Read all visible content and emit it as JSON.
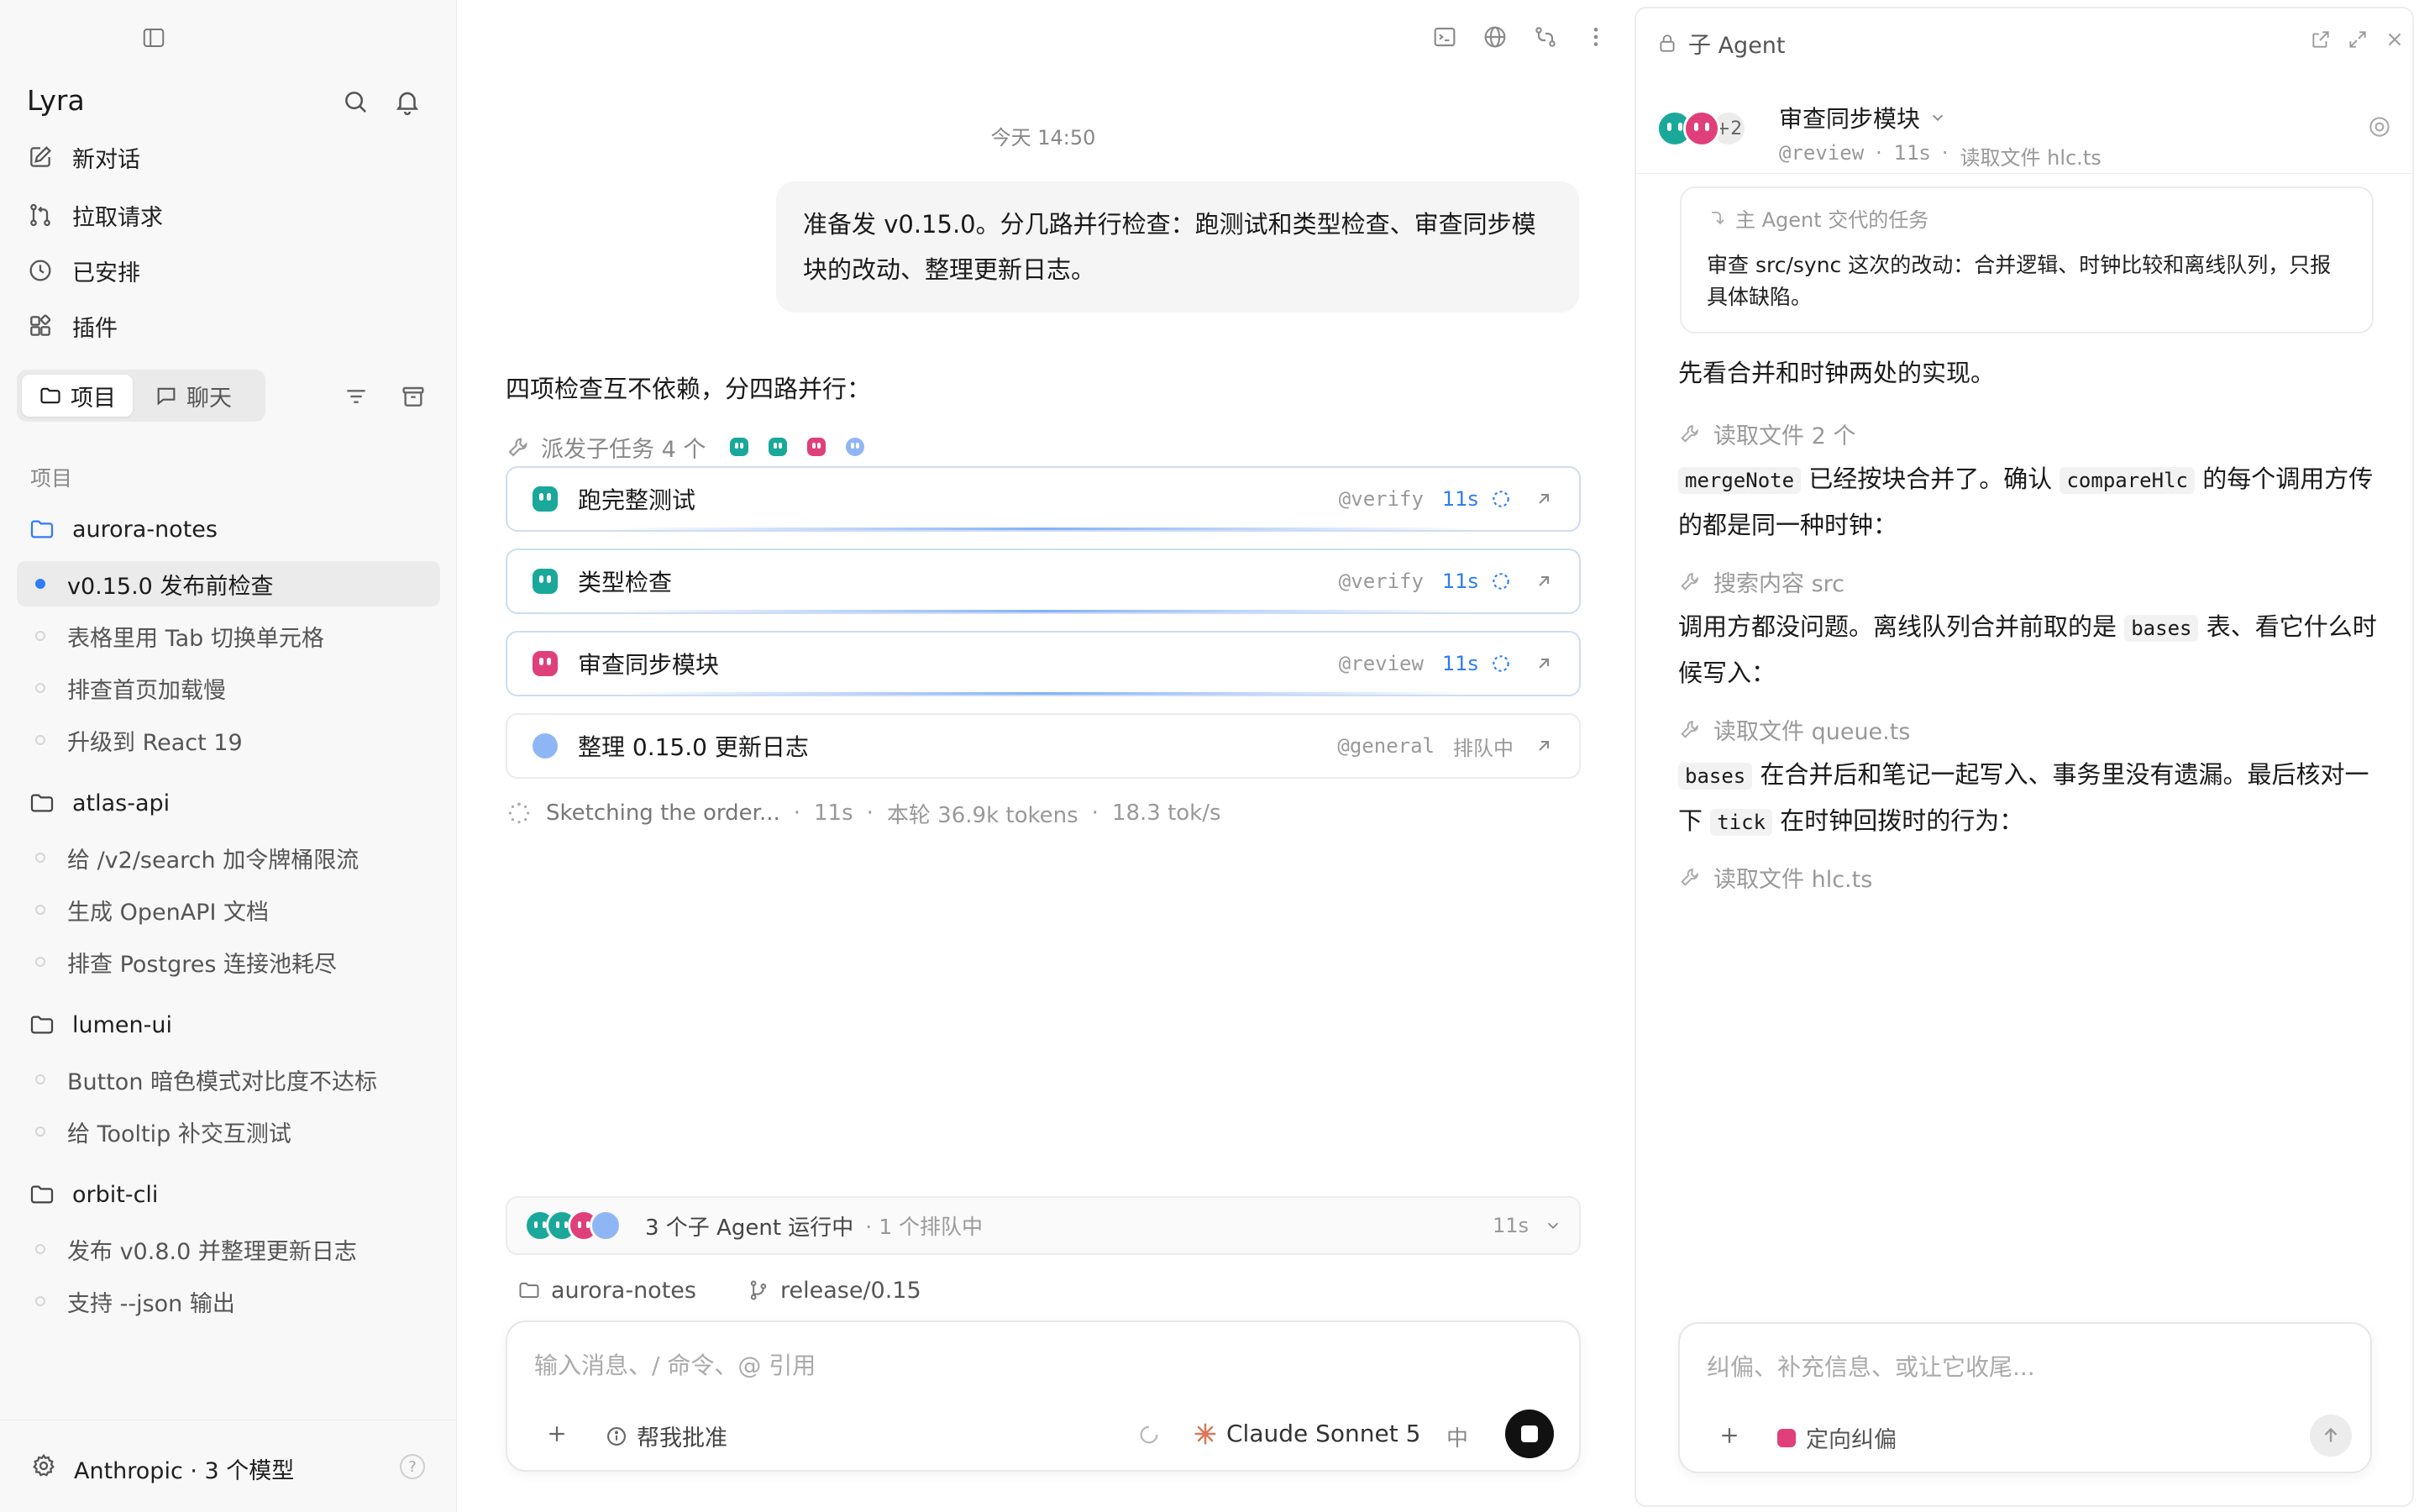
{
  "app": {
    "name": "Lyra"
  },
  "colors": {
    "teal": "#1aa89b",
    "magenta": "#e0407a",
    "queued": "#8fb6f4",
    "accent": "#2f7cf6"
  },
  "sidebar": {
    "nav": [
      {
        "label": "新对话",
        "icon": "compose-icon"
      },
      {
        "label": "拉取请求",
        "icon": "pull-request-icon"
      },
      {
        "label": "已安排",
        "icon": "clock-icon"
      },
      {
        "label": "插件",
        "icon": "plugins-icon"
      }
    ],
    "segments": [
      {
        "label": "项目",
        "active": true
      },
      {
        "label": "聊天",
        "active": false
      }
    ],
    "section_label": "项目",
    "projects": [
      {
        "name": "aurora-notes",
        "threads": [
          "v0.15.0 发布前检查",
          "表格里用 Tab 切换单元格",
          "排查首页加载慢",
          "升级到 React 19"
        ]
      },
      {
        "name": "atlas-api",
        "threads": [
          "给 /v2/search 加令牌桶限流",
          "生成 OpenAPI 文档",
          "排查 Postgres 连接池耗尽"
        ]
      },
      {
        "name": "lumen-ui",
        "threads": [
          "Button 暗色模式对比度不达标",
          "给 Tooltip 补交互测试"
        ]
      },
      {
        "name": "orbit-cli",
        "threads": [
          "发布 v0.8.0 并整理更新日志",
          "支持 --json 输出"
        ]
      }
    ],
    "active_thread": "v0.15.0 发布前检查",
    "footer": {
      "label": "Anthropic · 3 个模型",
      "help": "?"
    }
  },
  "main": {
    "timestamp": "今天 14:50",
    "user_message": "准备发 v0.15.0。分几路并行检查：跑测试和类型检查、审查同步模块的改动、整理更新日志。",
    "assistant_text": "四项检查互不依赖，分四路并行：",
    "dispatch_label": "派发子任务 4 个",
    "tasks": [
      {
        "name": "跑完整测试",
        "agent": "@verify",
        "time": "11s",
        "status": "running",
        "color": "#1aa89b"
      },
      {
        "name": "类型检查",
        "agent": "@verify",
        "time": "11s",
        "status": "running",
        "color": "#1aa89b"
      },
      {
        "name": "审查同步模块",
        "agent": "@review",
        "time": "11s",
        "status": "running",
        "color": "#e0407a"
      },
      {
        "name": "整理 0.15.0 更新日志",
        "agent": "@general",
        "time": "",
        "status_label": "排队中",
        "status": "queued",
        "color": "#8fb6f4"
      }
    ],
    "progress": {
      "text": "Sketching the order...",
      "time": "11s",
      "tokens": "本轮 36.9k tokens",
      "rate": "18.3 tok/s"
    },
    "agents_bar": {
      "title": "3 个子 Agent 运行中",
      "sub": "· 1 个排队中",
      "time": "11s"
    },
    "context": {
      "project": "aurora-notes",
      "branch": "release/0.15"
    },
    "composer": {
      "placeholder": "输入消息、/ 命令、@ 引用",
      "approve_label": "帮我批准",
      "model": "Claude Sonnet 5",
      "lang": "中"
    }
  },
  "right_panel": {
    "header": "子 Agent",
    "title": "审查同步模块",
    "more_count": "+2",
    "meta": {
      "agent": "@review",
      "time": "11s",
      "activity": "读取文件 hlc.ts"
    },
    "brief_label": "主 Agent 交代的任务",
    "brief_text": "审查 src/sync 这次的改动：合并逻辑、时钟比较和离线队列，只报具体缺陷。",
    "intro": "先看合并和时钟两处的实现。",
    "tool1": "读取文件 2 个",
    "p1": {
      "code1": "mergeNote",
      "t1": " 已经按块合并了。确认 ",
      "code2": "compareHlc",
      "t2": " 的每个调用方传的都是同一种时钟："
    },
    "tool2": "搜索内容 src",
    "p2": {
      "t1": "调用方都没问题。离线队列合并前取的是 ",
      "code1": "bases",
      "t2": " 表、看它什么时候写入："
    },
    "tool3": "读取文件 queue.ts",
    "p3": {
      "code1": "bases",
      "t1": " 在合并后和笔记一起写入、事务里没有遗漏。最后核对一下 ",
      "code2": "tick",
      "t2": " 在时钟回拨时的行为："
    },
    "tool4": "读取文件 hlc.ts",
    "composer": {
      "placeholder": "纠偏、补充信息、或让它收尾...",
      "steer_label": "定向纠偏"
    }
  }
}
